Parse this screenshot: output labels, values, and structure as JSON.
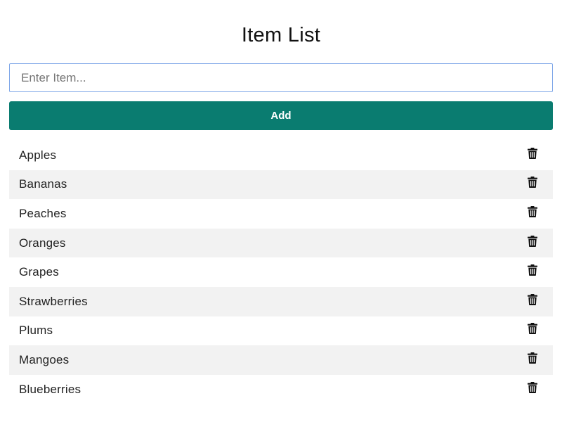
{
  "header": {
    "title": "Item List"
  },
  "form": {
    "input_value": "",
    "placeholder": "Enter Item...",
    "add_label": "Add",
    "accent_color": "#0a7c70"
  },
  "items": [
    {
      "label": "Apples",
      "icon": "trash-icon"
    },
    {
      "label": "Bananas",
      "icon": "trash-icon"
    },
    {
      "label": "Peaches",
      "icon": "trash-icon"
    },
    {
      "label": "Oranges",
      "icon": "trash-icon"
    },
    {
      "label": "Grapes",
      "icon": "trash-icon"
    },
    {
      "label": "Strawberries",
      "icon": "trash-icon"
    },
    {
      "label": "Plums",
      "icon": "trash-icon"
    },
    {
      "label": "Mangoes",
      "icon": "trash-icon"
    },
    {
      "label": "Blueberries",
      "icon": "trash-icon"
    }
  ]
}
